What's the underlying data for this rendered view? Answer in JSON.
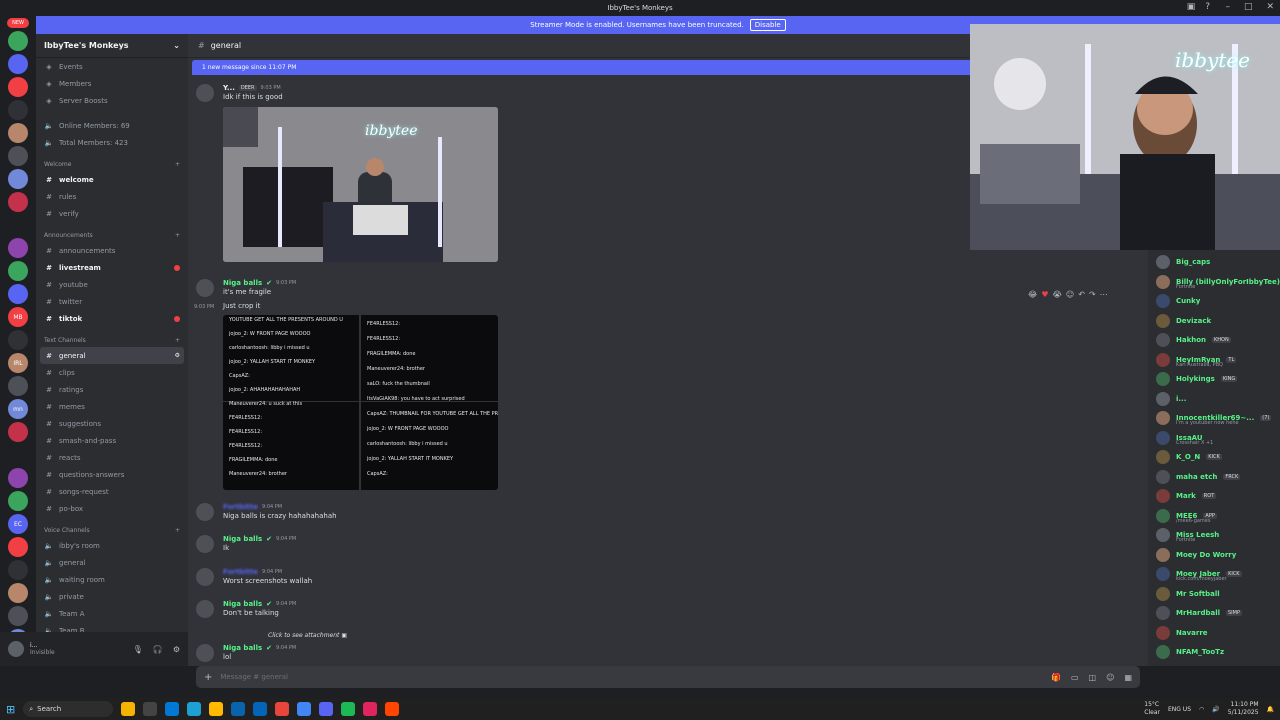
{
  "window": {
    "title": "IbbyTee's Monkeys"
  },
  "banner": {
    "text": "Streamer Mode is enabled. Usernames have been truncated.",
    "button": "Disable"
  },
  "guild_rail": {
    "new_label": "NEW",
    "items": [
      "",
      "",
      "",
      "",
      "",
      "",
      "",
      "",
      "",
      "",
      "",
      "",
      "MB",
      "",
      "IRL",
      "",
      "mn",
      "",
      "",
      "",
      "",
      "EC",
      "",
      "",
      "",
      "",
      "",
      "",
      "",
      ""
    ]
  },
  "server": {
    "name": "IbbyTee's Monkeys"
  },
  "sidebar": {
    "top_items": [
      {
        "label": "Events",
        "icon": "calendar-icon"
      },
      {
        "label": "Members",
        "icon": "members-icon"
      },
      {
        "label": "Server Boosts",
        "icon": "boost-icon"
      }
    ],
    "stats": [
      {
        "label": "Online Members: 69"
      },
      {
        "label": "Total Members: 423"
      }
    ],
    "categories": [
      {
        "name": "Welcome",
        "channels": [
          {
            "label": "welcome",
            "unread": true,
            "dot": false
          },
          {
            "label": "rules",
            "unread": false,
            "dot": false
          },
          {
            "label": "verify",
            "unread": false,
            "dot": false
          }
        ]
      },
      {
        "name": "Announcements",
        "channels": [
          {
            "label": "announcements",
            "unread": false,
            "dot": false
          },
          {
            "label": "livestream",
            "unread": true,
            "dot": true
          },
          {
            "label": "youtube",
            "unread": false,
            "dot": false
          },
          {
            "label": "twitter",
            "unread": false,
            "dot": false
          },
          {
            "label": "tiktok",
            "unread": true,
            "dot": true
          }
        ]
      },
      {
        "name": "Text Channels",
        "channels": [
          {
            "label": "general",
            "unread": false,
            "dot": false,
            "active": true
          },
          {
            "label": "clips",
            "unread": false,
            "dot": false
          },
          {
            "label": "ratings",
            "unread": false,
            "dot": false
          },
          {
            "label": "memes",
            "unread": false,
            "dot": false
          },
          {
            "label": "suggestions",
            "unread": false,
            "dot": false
          },
          {
            "label": "smash-and-pass",
            "unread": false,
            "dot": false
          },
          {
            "label": "reacts",
            "unread": false,
            "dot": false
          },
          {
            "label": "questions-answers",
            "unread": false,
            "dot": false
          },
          {
            "label": "songs-request",
            "unread": false,
            "dot": false
          },
          {
            "label": "po-box",
            "unread": false,
            "dot": false
          }
        ]
      },
      {
        "name": "Voice Channels",
        "channels": [
          {
            "label": "ibby's room"
          },
          {
            "label": "general"
          },
          {
            "label": "waiting room"
          },
          {
            "label": "private"
          },
          {
            "label": "Team A"
          },
          {
            "label": "Team B"
          }
        ]
      }
    ]
  },
  "user_panel": {
    "name": "i...",
    "status": "Invisible"
  },
  "chat": {
    "channel": "general",
    "new_messages_bar": "1 new message since 11:07 PM",
    "messages": [
      {
        "author": "Y...",
        "tag": "DEER",
        "time": "9:03 PM",
        "text": "Idk if this is good"
      },
      {
        "author": "Niga balls",
        "time": "9:03 PM",
        "text": "it's me fragile"
      },
      {
        "author": "",
        "time": "9:03 PM",
        "text": "Just crop it"
      },
      {
        "author": "Fortbitte",
        "time": "9:04 PM",
        "text": "Niga balls is crazy hahahahahah"
      },
      {
        "author": "Niga balls",
        "time": "9:04 PM",
        "text": "Ik"
      },
      {
        "author": "Fortbitte",
        "time": "9:04 PM",
        "text": "Worst screenshots wallah"
      },
      {
        "author": "Niga balls",
        "time": "9:04 PM",
        "text": "Don't be talking"
      },
      {
        "author": "Niga balls",
        "time": "9:04 PM",
        "text": "lol"
      }
    ],
    "image1_text": "ibbytee",
    "attachment": "Click to see attachment",
    "screenshot_lines_left": [
      "YOUTUBE GET ALL THE PRESENTS AROUND U",
      "jojoo_2: W FRONT PAGE WOOOO",
      "carloshantoosh: libby i missed u",
      "jojoo_2: YALLAH START IT MONKEY",
      "CapsAZ:",
      "jojoo_2: AHAHAHAHAHAHAH",
      "Maneuverer24: u suck at this",
      "FE4RLESS12:",
      "FE4RLESS12:",
      "FE4RLESS12:",
      "FRAGILEMMA: done",
      "Maneuverer24: brother"
    ],
    "screenshot_lines_right": [
      "FE4RLESS12:",
      "FE4RLESS12:",
      "FRAGILEMMA: done",
      "Maneuverer24: brother",
      "saLO: fuck the thumbnail",
      "ItsVaGiAK98: you have to act surprised",
      "CapsAZ: THUMBNAIL FOR YOUTUBE GET ALL THE PRESENTS AROUND U",
      "jojoo_2: W FRONT PAGE WOOOO",
      "carloshantoosh: libby i missed u",
      "jojoo_2: YALLAH START IT MONKEY",
      "CapsAZ:"
    ]
  },
  "composer": {
    "placeholder": "Message #  general"
  },
  "members": [
    {
      "name": "Big_caps",
      "tag": "",
      "sub": ""
    },
    {
      "name": "Billy (billyOnlyForIbbyTee)",
      "tag": "",
      "sub": "Fortnite"
    },
    {
      "name": "Cunky",
      "tag": "",
      "sub": ""
    },
    {
      "name": "Devizack",
      "tag": "",
      "sub": ""
    },
    {
      "name": "Hakhon",
      "tag": "KHON",
      "sub": ""
    },
    {
      "name": "HeyImRyan",
      "tag": "TL",
      "sub": "Karl Australia, PBQ"
    },
    {
      "name": "Holykings",
      "tag": "KING",
      "sub": ""
    },
    {
      "name": "i...",
      "tag": "",
      "sub": ""
    },
    {
      "name": "Innocentkiller69~...",
      "tag": "(7)",
      "sub": "I'm a youtuber now hehe"
    },
    {
      "name": "IssaAU",
      "tag": "",
      "sub": "Crosshair X +1"
    },
    {
      "name": "K_O_N",
      "tag": "KICK",
      "sub": ""
    },
    {
      "name": "maha etch",
      "tag": "FRCK",
      "sub": ""
    },
    {
      "name": "Mark",
      "tag": "ROT",
      "sub": ""
    },
    {
      "name": "MEE6",
      "tag": "APP",
      "sub": "/mee6-games"
    },
    {
      "name": "Miss Leesh",
      "tag": "",
      "sub": "Fortnite"
    },
    {
      "name": "Moey Do Worry",
      "tag": "",
      "sub": ""
    },
    {
      "name": "Moey Jaber",
      "tag": "KICK",
      "sub": "kick.com/moeyjaber"
    },
    {
      "name": "Mr Softball",
      "tag": "",
      "sub": ""
    },
    {
      "name": "MrHardball",
      "tag": "SIMP",
      "sub": ""
    },
    {
      "name": "Navarre",
      "tag": "",
      "sub": ""
    },
    {
      "name": "NFAM_TooTz",
      "tag": "",
      "sub": ""
    }
  ],
  "taskbar": {
    "search": "Search",
    "weather": "15°C",
    "weather_desc": "Clear",
    "locale": "ENG US",
    "time": "11:10 PM",
    "date": "5/11/2025"
  },
  "colors": {
    "accent": "#5865f2",
    "online_green": "#57f287",
    "danger": "#f23f43"
  }
}
